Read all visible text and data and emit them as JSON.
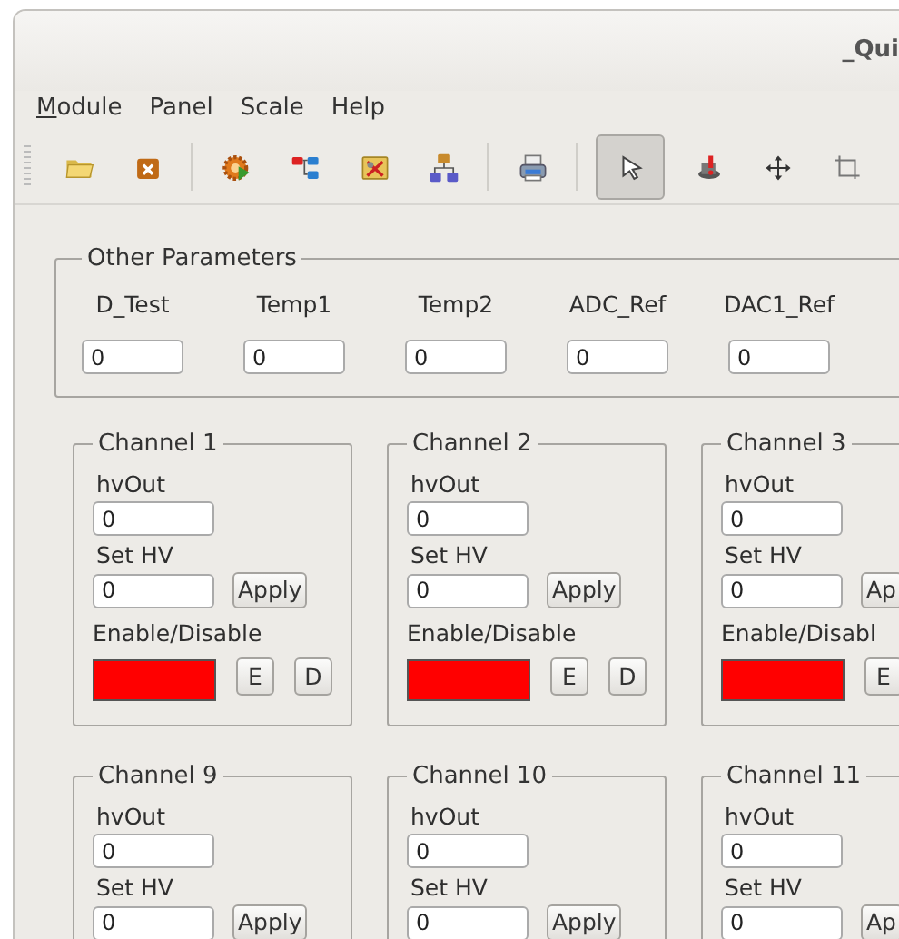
{
  "window": {
    "title": "_Qui"
  },
  "menu": [
    {
      "label": "Module",
      "mnemonic_first": true
    },
    {
      "label": "Panel",
      "mnemonic_first": false
    },
    {
      "label": "Scale",
      "mnemonic_first": false
    },
    {
      "label": "Help",
      "mnemonic_first": false
    }
  ],
  "toolbar": [
    {
      "kind": "button",
      "selected": false
    },
    {
      "kind": "button",
      "selected": false
    },
    {
      "kind": "separator"
    },
    {
      "kind": "button",
      "selected": false
    },
    {
      "kind": "button",
      "selected": false
    },
    {
      "kind": "button",
      "selected": false
    },
    {
      "kind": "button",
      "selected": false
    },
    {
      "kind": "separator"
    },
    {
      "kind": "button",
      "selected": false
    },
    {
      "kind": "separator"
    },
    {
      "kind": "button",
      "selected": true
    },
    {
      "kind": "button",
      "selected": false
    },
    {
      "kind": "button",
      "selected": false
    },
    {
      "kind": "button",
      "selected": false
    }
  ],
  "other_parameters": {
    "title": "Other Parameters",
    "params": [
      {
        "label": "D_Test",
        "value": "0"
      },
      {
        "label": "Temp1",
        "value": "0"
      },
      {
        "label": "Temp2",
        "value": "0"
      },
      {
        "label": "ADC_Ref",
        "value": "0"
      },
      {
        "label": "DAC1_Ref",
        "value": "0"
      }
    ]
  },
  "channel_rows": [
    [
      {
        "title": "Channel 1",
        "hv_out_label": "hvOut",
        "hv_out": "0",
        "set_hv_label": "Set HV",
        "set_hv": "0",
        "apply": "Apply",
        "enable_label": "Enable/Disable",
        "color": "#ff0000",
        "enable": "E",
        "disable": "D"
      },
      {
        "title": "Channel 2",
        "hv_out_label": "hvOut",
        "hv_out": "0",
        "set_hv_label": "Set HV",
        "set_hv": "0",
        "apply": "Apply",
        "enable_label": "Enable/Disable",
        "color": "#ff0000",
        "enable": "E",
        "disable": "D"
      },
      {
        "title": "Channel 3",
        "hv_out_label": "hvOut",
        "hv_out": "0",
        "set_hv_label": "Set HV",
        "set_hv": "0",
        "apply": "Ap",
        "enable_label": "Enable/Disabl",
        "color": "#ff0000",
        "enable": "E"
      }
    ],
    [
      {
        "title": "Channel 9",
        "hv_out_label": "hvOut",
        "hv_out": "0",
        "set_hv_label": "Set HV",
        "set_hv": "0",
        "apply": "Apply"
      },
      {
        "title": "Channel 10",
        "hv_out_label": "hvOut",
        "hv_out": "0",
        "set_hv_label": "Set HV",
        "set_hv": "0",
        "apply": "Apply"
      },
      {
        "title": "Channel 11",
        "hv_out_label": "hvOut",
        "hv_out": "0",
        "set_hv_label": "Set HV",
        "set_hv": "0",
        "apply": "Ap"
      }
    ]
  ]
}
